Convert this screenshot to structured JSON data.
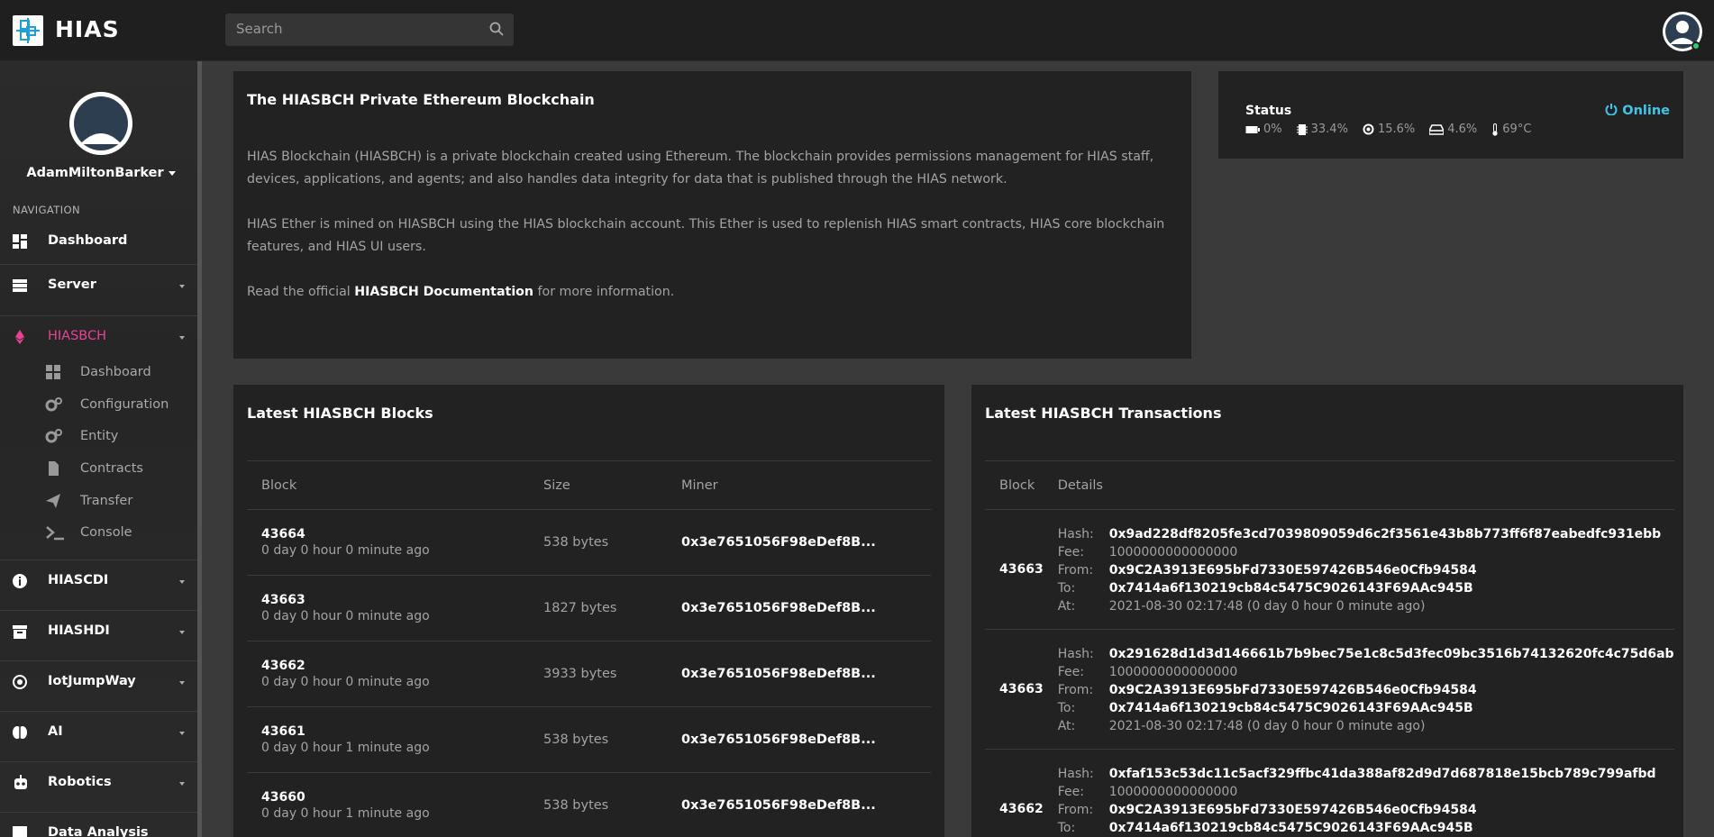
{
  "app": {
    "name": "HIAS"
  },
  "search": {
    "placeholder": "Search"
  },
  "sidebar": {
    "user": "AdamMiltonBarker",
    "nav_heading": "NAVIGATION",
    "items": [
      {
        "label": "Dashboard",
        "icon": "dashboard-icon"
      },
      {
        "label": "Server",
        "icon": "server-icon"
      },
      {
        "label": "HIASBCH",
        "icon": "ethereum-icon",
        "active": true
      },
      {
        "label": "HIASCDI",
        "icon": "info-icon"
      },
      {
        "label": "HIASHDI",
        "icon": "archive-icon"
      },
      {
        "label": "IotJumpWay",
        "icon": "chip-icon"
      },
      {
        "label": "AI",
        "icon": "brain-icon"
      },
      {
        "label": "Robotics",
        "icon": "robot-icon"
      },
      {
        "label": "Data Analysis",
        "icon": "chart-icon"
      }
    ],
    "sub_items": [
      {
        "label": "Dashboard",
        "icon": "dashboard-icon"
      },
      {
        "label": "Configuration",
        "icon": "gears-icon"
      },
      {
        "label": "Entity",
        "icon": "gears-icon"
      },
      {
        "label": "Contracts",
        "icon": "file-icon"
      },
      {
        "label": "Transfer",
        "icon": "send-icon"
      },
      {
        "label": "Console",
        "icon": "terminal-icon"
      }
    ]
  },
  "intro": {
    "title": "The HIASBCH Private Ethereum Blockchain",
    "p1": "HIAS Blockchain (HIASBCH) is a private blockchain created using Ethereum. The blockchain provides permissions management for HIAS staff, devices, applications, and agents; and also handles data integrity for data that is published through the HIAS network.",
    "p2": "HIAS Ether is mined on HIASBCH using the HIAS blockchain account. This Ether is used to replenish HIAS smart contracts, HIAS core blockchain features, and HIAS UI users.",
    "p3_before": "Read the official ",
    "p3_link": "HIASBCH Documentation",
    "p3_after": " for more information."
  },
  "status": {
    "title": "Status",
    "online": "Online",
    "battery": "0%",
    "cpu": "33.4%",
    "memory": "15.6%",
    "disk": "4.6%",
    "temp": "69°C",
    "online_color": "#3fc6e8"
  },
  "blocks": {
    "title": "Latest HIASBCH Blocks",
    "headers": [
      "Block",
      "Size",
      "Miner"
    ],
    "rows": [
      {
        "block": "43664",
        "age": "0 day 0 hour 0 minute ago",
        "size": "538 bytes",
        "miner": "0x3e7651056F98eDef8B..."
      },
      {
        "block": "43663",
        "age": "0 day 0 hour 0 minute ago",
        "size": "1827 bytes",
        "miner": "0x3e7651056F98eDef8B..."
      },
      {
        "block": "43662",
        "age": "0 day 0 hour 0 minute ago",
        "size": "3933 bytes",
        "miner": "0x3e7651056F98eDef8B..."
      },
      {
        "block": "43661",
        "age": "0 day 0 hour 1 minute ago",
        "size": "538 bytes",
        "miner": "0x3e7651056F98eDef8B..."
      },
      {
        "block": "43660",
        "age": "0 day 0 hour 1 minute ago",
        "size": "538 bytes",
        "miner": "0x3e7651056F98eDef8B..."
      }
    ]
  },
  "transactions": {
    "title": "Latest HIASBCH Transactions",
    "headers": [
      "Block",
      "Details"
    ],
    "labels": {
      "hash": "Hash:",
      "fee": "Fee:",
      "from": "From:",
      "to": "To:",
      "at": "At:"
    },
    "rows": [
      {
        "block": "43663",
        "hash": "0x9ad228df8205fe3cd7039809059d6c2f3561e43b8b773ff6f87eabedfc931ebb",
        "fee": "1000000000000000",
        "from": "0x9C2A3913E695bFd7330E597426B546e0Cfb94584",
        "to": "0x7414a6f130219cb84c5475C9026143F69AAc945B",
        "at": "2021-08-30 02:17:48 (0 day 0 hour 0 minute ago)"
      },
      {
        "block": "43663",
        "hash": "0x291628d1d3d146661b7b9bec75e1c8c5d3fec09bc3516b74132620fc4c75d6ab",
        "fee": "1000000000000000",
        "from": "0x9C2A3913E695bFd7330E597426B546e0Cfb94584",
        "to": "0x7414a6f130219cb84c5475C9026143F69AAc945B",
        "at": "2021-08-30 02:17:48 (0 day 0 hour 0 minute ago)"
      },
      {
        "block": "43662",
        "hash": "0xfaf153c53dc11c5acf329ffbc41da388af82d9d7d687818e15bcb789c799afbd",
        "fee": "1000000000000000",
        "from": "0x9C2A3913E695bFd7330E597426B546e0Cfb94584",
        "to": "0x7414a6f130219cb84c5475C9026143F69AAc945B",
        "at": ""
      }
    ]
  }
}
